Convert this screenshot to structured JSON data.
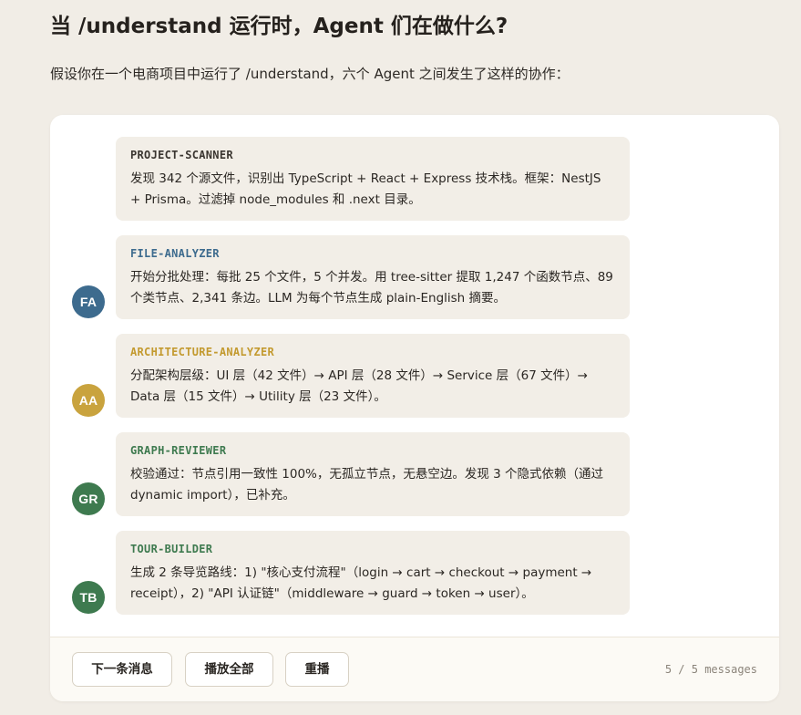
{
  "heading": "当 /understand 运行时，Agent 们在做什么?",
  "intro": "假设你在一个电商项目中运行了 /understand，六个 Agent 之间发生了这样的协作：",
  "messages": [
    {
      "avatar": "",
      "sender": "PROJECT-SCANNER",
      "sender_color": "#3a3530",
      "text": "发现 342 个源文件，识别出 TypeScript + React + Express 技术栈。框架：NestJS + Prisma。过滤掉 node_modules 和 .next 目录。"
    },
    {
      "avatar": "FA",
      "avatar_color": "#3d6b8e",
      "sender": "FILE-ANALYZER",
      "sender_color": "#3d6b8e",
      "text": "开始分批处理：每批 25 个文件，5 个并发。用 tree-sitter 提取 1,247 个函数节点、89 个类节点、2,341 条边。LLM 为每个节点生成 plain-English 摘要。"
    },
    {
      "avatar": "AA",
      "avatar_color": "#c9a33e",
      "sender": "ARCHITECTURE-ANALYZER",
      "sender_color": "#c39a2f",
      "text": "分配架构层级：UI 层（42 文件）→ API 层（28 文件）→ Service 层（67 文件）→ Data 层（15 文件）→ Utility 层（23 文件）。"
    },
    {
      "avatar": "GR",
      "avatar_color": "#3e7a4f",
      "sender": "GRAPH-REVIEWER",
      "sender_color": "#3e7a4f",
      "text": "校验通过：节点引用一致性 100%，无孤立节点，无悬空边。发现 3 个隐式依赖（通过 dynamic import），已补充。"
    },
    {
      "avatar": "TB",
      "avatar_color": "#3e7a4f",
      "sender": "TOUR-BUILDER",
      "sender_color": "#3e7a4f",
      "text": "生成 2 条导览路线：1) \"核心支付流程\"（login → cart → checkout → payment → receipt），2) \"API 认证链\"（middleware → guard → token → user）。"
    }
  ],
  "controls": {
    "next_label": "下一条消息",
    "play_all_label": "播放全部",
    "replay_label": "重播",
    "counter": "5 / 5 messages"
  }
}
